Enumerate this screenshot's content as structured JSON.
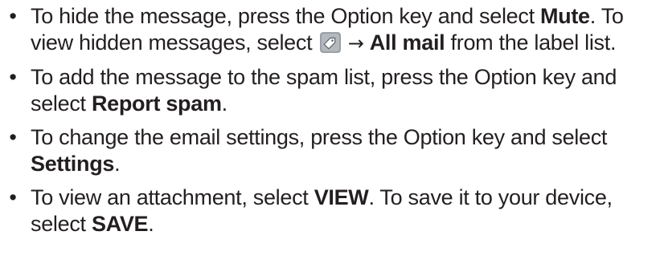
{
  "bullets": [
    {
      "line1_pre": "To hide the message, press the Option key and select ",
      "line1_bold": "Mute",
      "line1_post": ".",
      "line2_pre": "To view hidden messages, select ",
      "arrow": "→",
      "line2_bold": "All mail",
      "line2_post": " from the label list."
    },
    {
      "pre": "To add the message to the spam list, press the Option key and select ",
      "bold": "Report spam",
      "post": "."
    },
    {
      "pre": "To change the email settings, press the Option key and select ",
      "bold": "Settings",
      "post": "."
    },
    {
      "pre": "To view an attachment, select ",
      "bold1": "VIEW",
      "mid": ". To save it to your device, select ",
      "bold2": "SAVE",
      "post": "."
    }
  ],
  "bullet_glyph": "•",
  "icons": {
    "label_icon": "label-tag-icon"
  },
  "colors": {
    "text": "#231f20",
    "icon_bg": "#9aa0a6"
  }
}
